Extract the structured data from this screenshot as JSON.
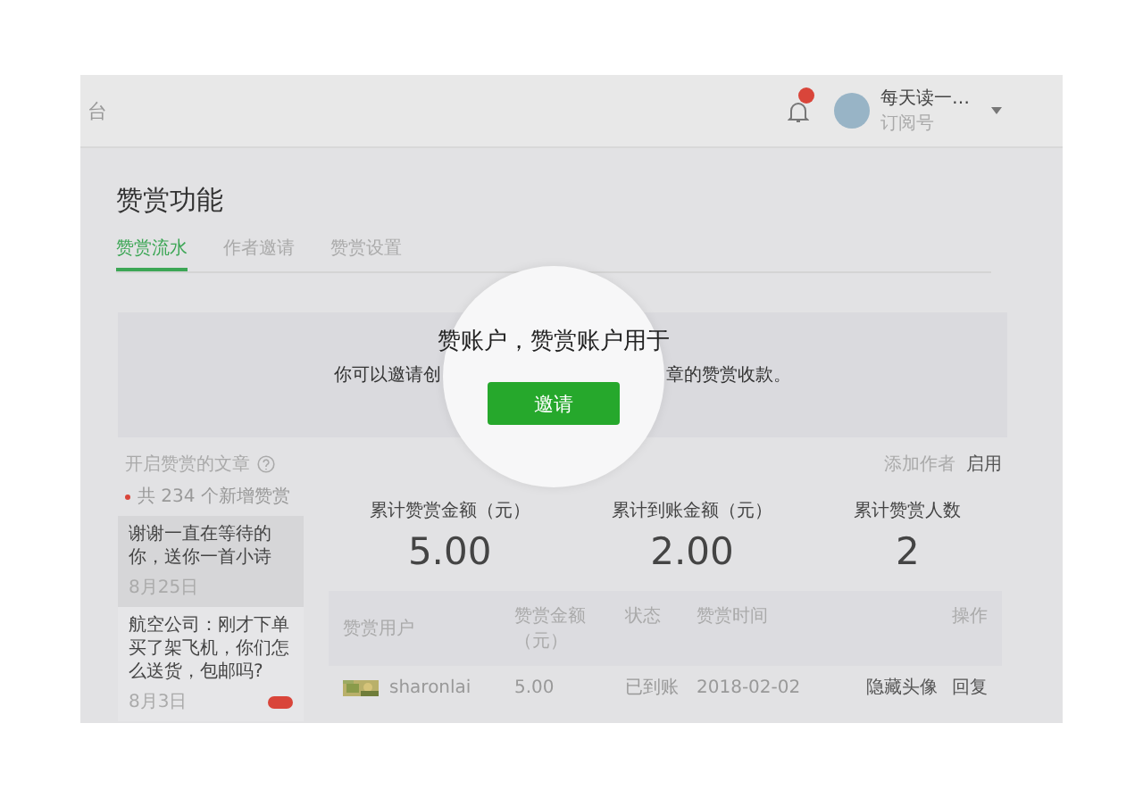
{
  "header": {
    "cut_title": "台",
    "notification_badge": true,
    "account": {
      "name": "每天读一…",
      "subtitle": "订阅号"
    }
  },
  "page_title": "赞赏功能",
  "tabs": [
    {
      "label": "赞赏流水",
      "selected": true
    },
    {
      "label": "作者邀请",
      "selected": false
    },
    {
      "label": "赞赏设置",
      "selected": false
    }
  ],
  "banner": {
    "text_left": "你可以邀请创",
    "text_magnified": "赞账户，赞赏账户用于",
    "text_right": "章的赞赏收款。",
    "button": "邀请"
  },
  "articles_panel": {
    "heading": "开启赞赏的文章",
    "new_count": "共 234 个新增赞赏",
    "articles": [
      {
        "title": "谢谢一直在等待的你，送你一首小诗",
        "date": "8月25日",
        "selected": true,
        "badge": false
      },
      {
        "title": "航空公司：刚才下单买了架飞机，你们怎么送货，包邮吗?",
        "date": "8月3日",
        "selected": false,
        "badge": true
      }
    ]
  },
  "author_actions": {
    "label": "添加作者",
    "action": "启用"
  },
  "stats": [
    {
      "label": "累计赞赏金额（元）",
      "value": "5.00"
    },
    {
      "label": "累计到账金额（元）",
      "value": "2.00"
    },
    {
      "label": "累计赞赏人数",
      "value": "2"
    }
  ],
  "table": {
    "columns": [
      "赞赏用户",
      "赞赏金额（元）",
      "状态",
      "赞赏时间",
      "操作"
    ],
    "rows": [
      {
        "user": "sharonlai",
        "amount": "5.00",
        "status": "已到账",
        "time": "2018-02-02",
        "actions": [
          "隐藏头像",
          "回复"
        ]
      }
    ]
  }
}
